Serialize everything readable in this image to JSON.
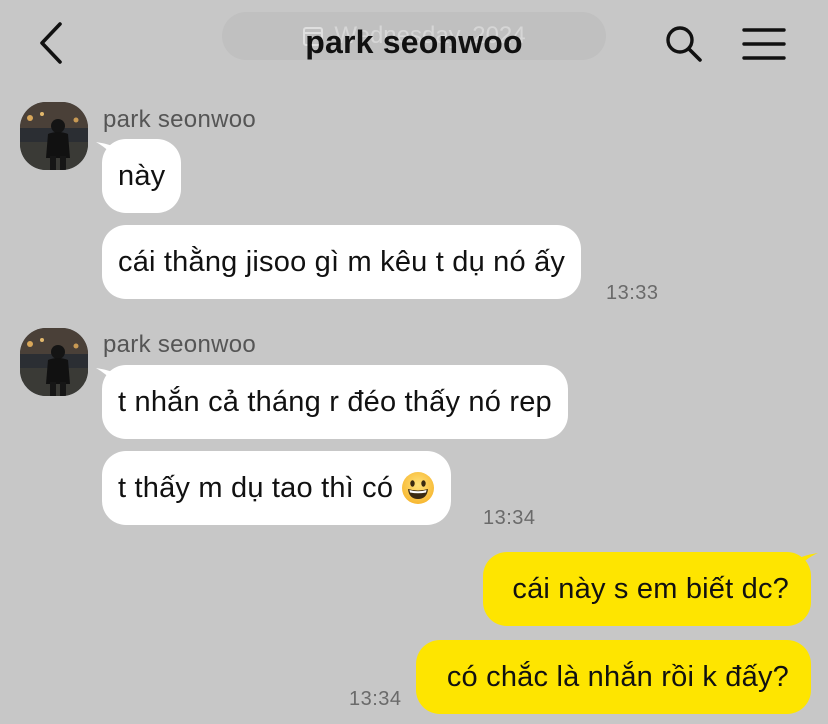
{
  "header": {
    "title": "park seonwoo",
    "date_pill": "Wednesday, 2024"
  },
  "messages": [
    {
      "sender": "park seonwoo",
      "bubbles": [
        "này",
        "cái thằng jisoo gì m kêu t dụ nó ấy"
      ],
      "time": "13:33"
    },
    {
      "sender": "park seonwoo",
      "bubbles": [
        "t nhắn cả tháng r đéo thấy nó rep",
        "t thấy m dụ tao thì có"
      ],
      "time": "13:34"
    }
  ],
  "my_messages": {
    "bubbles": [
      "cái này s em biết dc?",
      "có chắc là nhắn rồi k đấy?"
    ],
    "time": "13:34"
  },
  "colors": {
    "background": "#c7c7c7",
    "incoming_bubble": "#ffffff",
    "outgoing_bubble": "#fee500"
  },
  "icons": {
    "back": "chevron-left-icon",
    "search": "search-icon",
    "menu": "hamburger-menu-icon",
    "emoji": "grinning-face-emoji"
  }
}
